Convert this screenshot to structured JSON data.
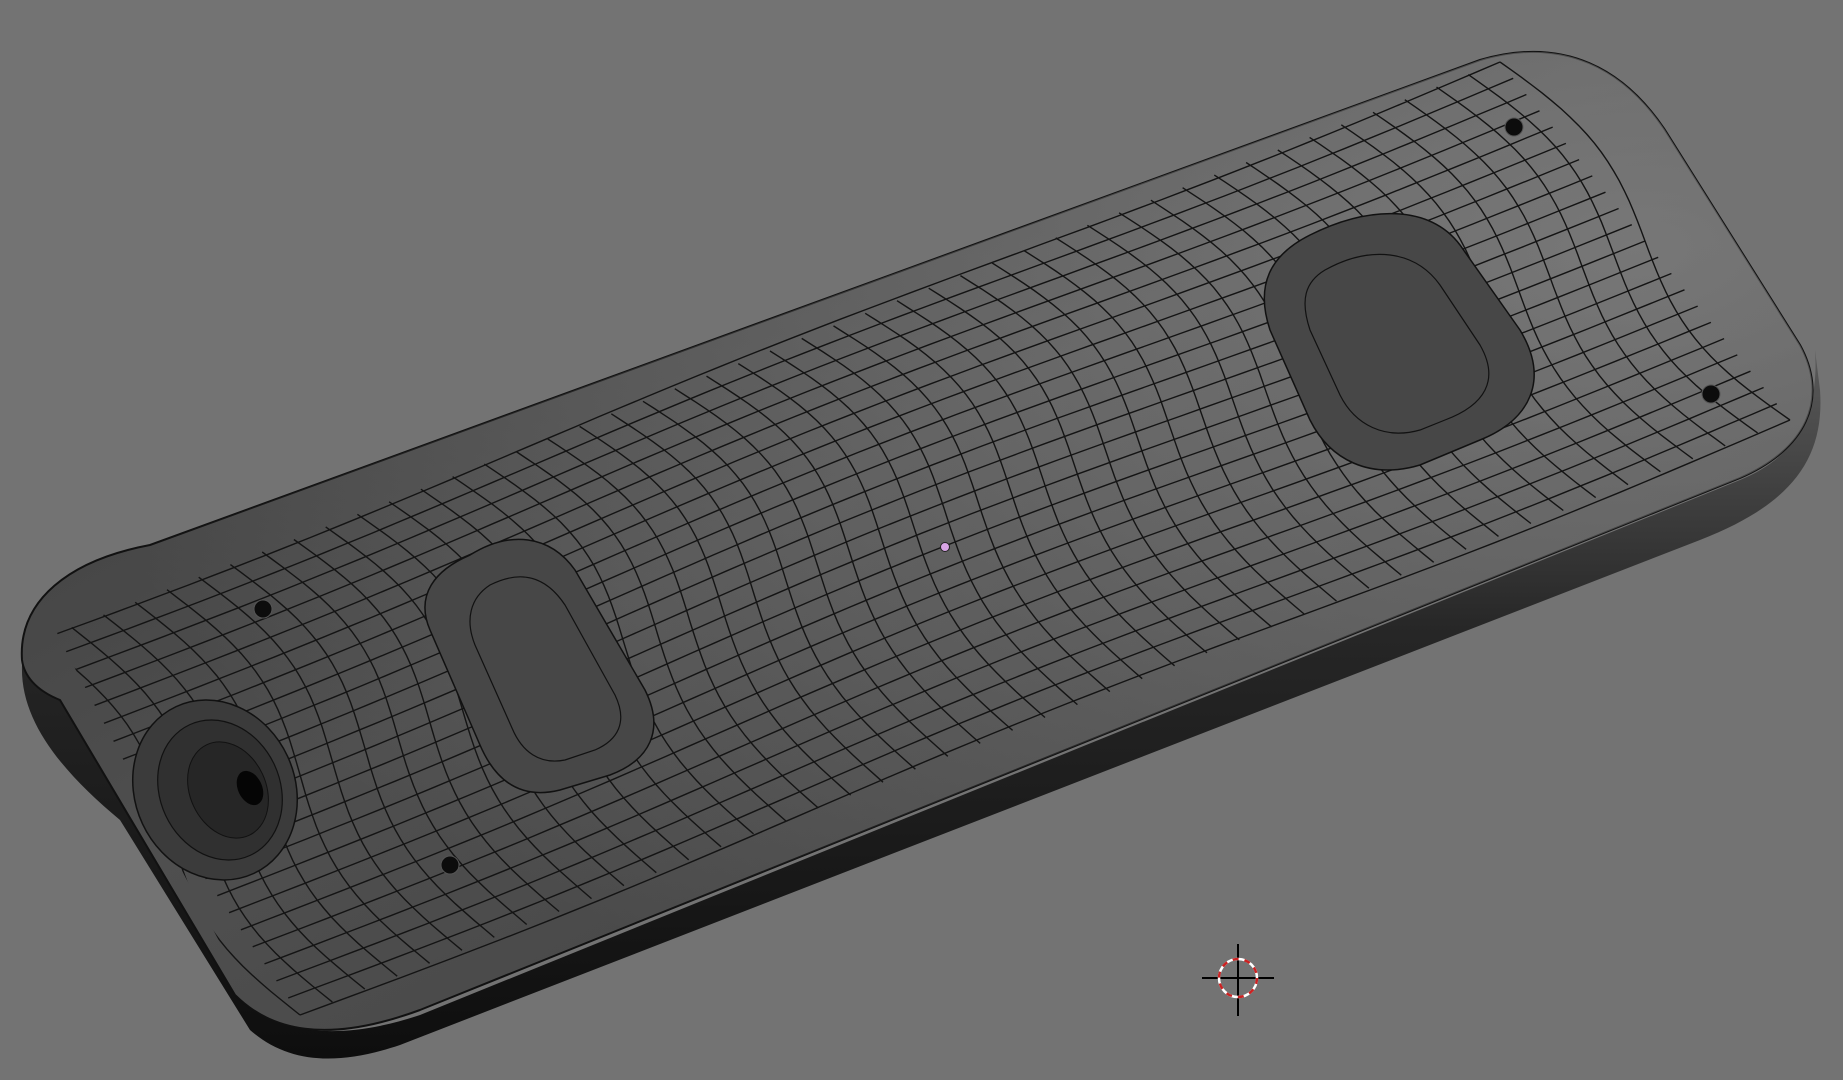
{
  "viewport": {
    "background": "#737373",
    "object": {
      "name": "mesh-object",
      "fill_dark": "#2a2a2a",
      "fill_mid": "#4a4a4a",
      "fill_light": "#6a6a6a",
      "wire_color": "#111111"
    },
    "origin_dot_color": "#d9a5e6",
    "cursor_colors": [
      "#000000",
      "#cc2222",
      "#ffffff"
    ]
  }
}
